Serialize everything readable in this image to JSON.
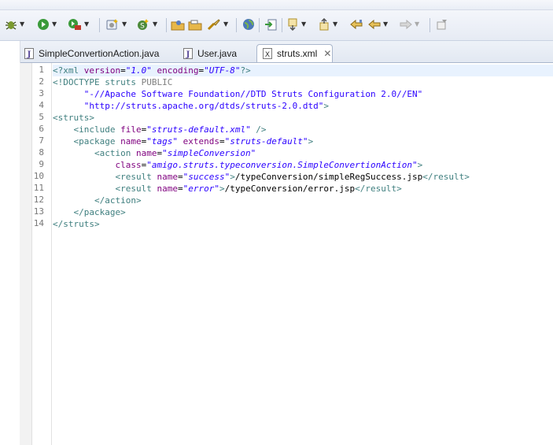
{
  "toolbar": {
    "buttons": [
      {
        "name": "debug-icon"
      },
      {
        "name": "run-icon"
      },
      {
        "name": "external-tools-icon"
      },
      {
        "name": "new-server-icon"
      },
      {
        "name": "new-class-icon"
      },
      {
        "name": "open-type-icon"
      },
      {
        "name": "open-resource-icon"
      },
      {
        "name": "search-icon"
      },
      {
        "name": "web-browser-icon"
      },
      {
        "name": "toggle-mark-icon"
      },
      {
        "name": "next-annotation-icon"
      },
      {
        "name": "previous-annotation-icon"
      },
      {
        "name": "last-edit-location-icon"
      },
      {
        "name": "back-icon"
      },
      {
        "name": "forward-icon"
      },
      {
        "name": "pin-editor-icon"
      }
    ]
  },
  "tabs": [
    {
      "label": "SimpleConvertionAction.java",
      "kind": "java",
      "active": false
    },
    {
      "label": "User.java",
      "kind": "java",
      "active": false
    },
    {
      "label": "struts.xml",
      "kind": "xml",
      "active": true
    }
  ],
  "editor": {
    "line_numbers": [
      "1",
      "2",
      "3",
      "4",
      "5",
      "6",
      "7",
      "8",
      "9",
      "10",
      "11",
      "12",
      "13",
      "14"
    ],
    "lines": [
      [
        [
          "pi",
          "<?xml "
        ],
        [
          "attr",
          "version"
        ],
        [
          "txt",
          "="
        ],
        [
          "val",
          "\"1.0\""
        ],
        [
          "txt",
          " "
        ],
        [
          "attr",
          "encoding"
        ],
        [
          "txt",
          "="
        ],
        [
          "val",
          "\"UTF-8\""
        ],
        [
          "pi",
          "?>"
        ]
      ],
      [
        [
          "tag",
          "<!DOCTYPE "
        ],
        [
          "tag",
          "struts"
        ],
        [
          "doc",
          " PUBLIC"
        ]
      ],
      [
        [
          "txt",
          "      "
        ],
        [
          "str",
          "\"-//Apache Software Foundation//DTD Struts Configuration 2.0//EN\""
        ]
      ],
      [
        [
          "txt",
          "      "
        ],
        [
          "str",
          "\"http://struts.apache.org/dtds/struts-2.0.dtd\""
        ],
        [
          "tag",
          ">"
        ]
      ],
      [
        [
          "tag",
          "<struts>"
        ]
      ],
      [
        [
          "txt",
          "    "
        ],
        [
          "tag",
          "<include "
        ],
        [
          "attr",
          "file"
        ],
        [
          "txt",
          "="
        ],
        [
          "val",
          "\"struts-default.xml\""
        ],
        [
          "tag",
          " />"
        ]
      ],
      [
        [
          "txt",
          "    "
        ],
        [
          "tag",
          "<package "
        ],
        [
          "attr",
          "name"
        ],
        [
          "txt",
          "="
        ],
        [
          "val",
          "\"tags\""
        ],
        [
          "txt",
          " "
        ],
        [
          "attr",
          "extends"
        ],
        [
          "txt",
          "="
        ],
        [
          "val",
          "\"struts-default\""
        ],
        [
          "tag",
          ">"
        ]
      ],
      [
        [
          "txt",
          "        "
        ],
        [
          "tag",
          "<action "
        ],
        [
          "attr",
          "name"
        ],
        [
          "txt",
          "="
        ],
        [
          "val",
          "\"simpleConversion\""
        ]
      ],
      [
        [
          "txt",
          "            "
        ],
        [
          "attr",
          "class"
        ],
        [
          "txt",
          "="
        ],
        [
          "val",
          "\"amigo.struts.typeconversion.SimpleConvertionAction\""
        ],
        [
          "tag",
          ">"
        ]
      ],
      [
        [
          "txt",
          "            "
        ],
        [
          "tag",
          "<result "
        ],
        [
          "attr",
          "name"
        ],
        [
          "txt",
          "="
        ],
        [
          "val",
          "\"success\""
        ],
        [
          "tag",
          ">"
        ],
        [
          "txt",
          "/typeConversion/simpleRegSuccess.jsp"
        ],
        [
          "tag",
          "</result>"
        ]
      ],
      [
        [
          "txt",
          "            "
        ],
        [
          "tag",
          "<result "
        ],
        [
          "attr",
          "name"
        ],
        [
          "txt",
          "="
        ],
        [
          "val",
          "\"error\""
        ],
        [
          "tag",
          ">"
        ],
        [
          "txt",
          "/typeConversion/error.jsp"
        ],
        [
          "tag",
          "</result>"
        ]
      ],
      [
        [
          "txt",
          "        "
        ],
        [
          "tag",
          "</action>"
        ]
      ],
      [
        [
          "txt",
          "    "
        ],
        [
          "tag",
          "</package>"
        ]
      ],
      [
        [
          "tag",
          "</struts>"
        ]
      ]
    ]
  }
}
